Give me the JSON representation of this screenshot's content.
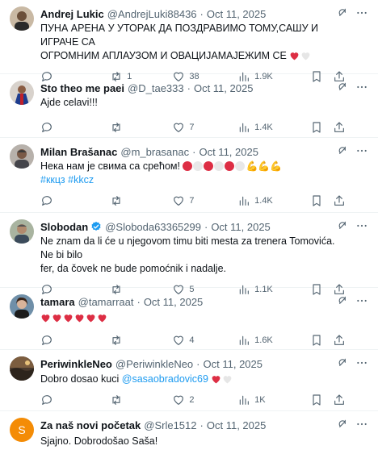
{
  "timeline": {
    "tweets": [
      {
        "name": "Andrej Lukic",
        "handle": "@AndrejLuki88436",
        "date": "Oct 11, 2025",
        "text_lines": [
          "ПУНА АРЕНА У УТОРАК ДА ПОЗДРАВИМО ТОМУ,САШУ И ИГРАЧЕ СА",
          "ОГРОМНИМ АПЛАУЗОМ И ОВАЦИЈАМАЈЕЖИМ СЕ"
        ],
        "emoji": [
          "red-heart",
          "white-heart"
        ],
        "replies": "",
        "reposts": "1",
        "likes": "38",
        "views": "1.9K",
        "avatar_icon": "photo-avatar"
      },
      {
        "name": "Sto theo me paei",
        "handle": "@D_tae333",
        "date": "Oct 11, 2025",
        "text_lines": [
          "Ajde celavi!!!"
        ],
        "replies": "",
        "reposts": "",
        "likes": "7",
        "views": "1.4K",
        "avatar_icon": "photo-avatar"
      },
      {
        "name": "Milan Brašanac",
        "handle": "@m_brasanac",
        "date": "Oct 11, 2025",
        "text_lines": [
          "Нека нам је свима са срећом!"
        ],
        "emoji": [
          "red-circle",
          "white-circle",
          "red-circle",
          "white-circle",
          "red-circle",
          "white-circle",
          "flexed-biceps",
          "flexed-biceps",
          "flexed-biceps"
        ],
        "hashtags": [
          "#ккцз",
          "#kkcz"
        ],
        "replies": "",
        "reposts": "",
        "likes": "7",
        "views": "1.4K",
        "avatar_icon": "photo-avatar"
      },
      {
        "name": "Slobodan",
        "handle": "@Sloboda63365299",
        "date": "Oct 11, 2025",
        "verified": true,
        "text_lines": [
          "Ne znam da li će u njegovom timu biti mesta za trenera Tomovića. Ne bi bilo",
          "fer, da čovek ne bude pomoćnik i nadalje."
        ],
        "replies": "",
        "reposts": "",
        "likes": "5",
        "views": "1.1K",
        "avatar_icon": "photo-avatar"
      },
      {
        "name": "tamara",
        "handle": "@tamarraat",
        "date": "Oct 11, 2025",
        "text_lines": [
          ""
        ],
        "emoji": [
          "red-heart",
          "red-heart",
          "red-heart",
          "red-heart",
          "red-heart",
          "red-heart"
        ],
        "replies": "",
        "reposts": "",
        "likes": "4",
        "views": "1.6K",
        "avatar_icon": "photo-avatar"
      },
      {
        "name": "PeriwinkleNeo",
        "handle": "@PeriwinkleNeo",
        "date": "Oct 11, 2025",
        "text_lines": [
          "Dobro dosao kuci"
        ],
        "mention": "@sasaobradovic69",
        "emoji": [
          "red-heart",
          "white-heart"
        ],
        "replies": "",
        "reposts": "",
        "likes": "2",
        "views": "1K",
        "avatar_icon": "photo-avatar"
      },
      {
        "name": "Za naš novi početak",
        "handle": "@Srle1512",
        "date": "Oct 11, 2025",
        "text_lines": [
          "Sjajno. Dobrodošao Saša!"
        ],
        "avatar_initial": "S",
        "avatar_color": "#f48c06"
      }
    ]
  },
  "colors": {
    "text": "#0f1419",
    "secondary": "#536471",
    "link": "#1d9bf0",
    "divider": "#eff3f4",
    "verified": "#1d9bf0"
  }
}
